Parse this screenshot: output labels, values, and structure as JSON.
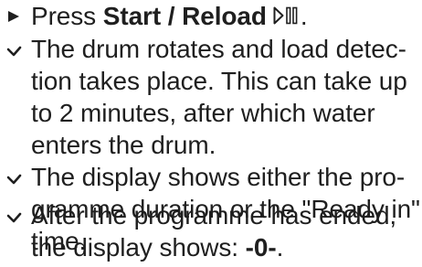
{
  "instructions": {
    "step": {
      "prefix": "Press ",
      "bold": "Start / Reload",
      "suffix": "."
    },
    "results": [
      {
        "lines": [
          "The drum rotates and load detec-",
          "tion takes place. This can take up",
          "to 2 minutes, after which water",
          "enters the drum."
        ]
      },
      {
        "lines": [
          "The display shows either the pro-",
          "gramme duration or the \"Ready in\"",
          "time."
        ]
      },
      {
        "line1": "After the programme has ended,",
        "line2_prefix": "the display shows: ",
        "line2_bold": "-0-",
        "line2_suffix": "."
      }
    ]
  }
}
